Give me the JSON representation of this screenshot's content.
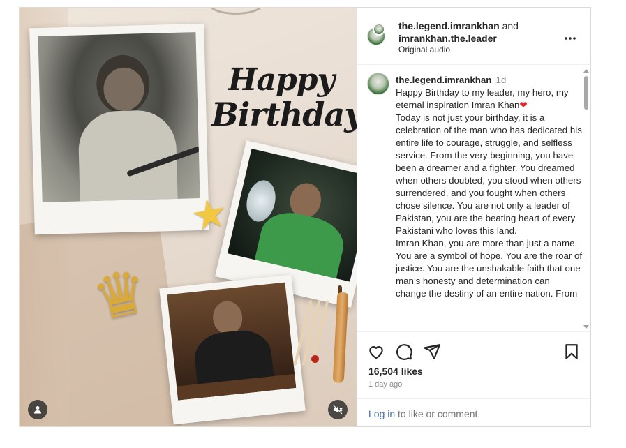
{
  "media": {
    "title_line1": "Happy",
    "title_line2": "Birthday",
    "icons": [
      "user-tag-icon",
      "mute-icon",
      "star-icon",
      "crown-icon"
    ]
  },
  "header": {
    "user1": "the.legend.imrankhan",
    "joiner": "and",
    "user2": "imrankhan.the.leader",
    "audio": "Original audio",
    "more_icon": "more-options-icon"
  },
  "caption": {
    "username": "the.legend.imrankhan",
    "time": "1d",
    "paragraphs": [
      "Happy Birthday to my leader, my hero, my eternal inspiration Imran Khan",
      "Today is not just your birthday, it is a celebration of the man who has dedicated his entire life to courage, struggle, and selfless service. From the very beginning, you have been a dreamer and a fighter. You dreamed when others doubted, you stood when others surrendered, and you fought when others chose silence. You are not only a leader of Pakistan, you are the beating heart of every Pakistani who loves this land.",
      "Imran Khan, you are more than just a name. You are a symbol of hope. You are the roar of justice. You are the unshakable faith that one man’s honesty and determination can change the destiny of an entire nation. From"
    ],
    "heart": "❤"
  },
  "actions": {
    "icons": [
      "like-heart-icon",
      "comment-icon",
      "share-icon",
      "save-bookmark-icon"
    ]
  },
  "likes": "16,504 likes",
  "posted": "1 day ago",
  "login": {
    "link": "Log in",
    "rest": "to like or comment."
  }
}
